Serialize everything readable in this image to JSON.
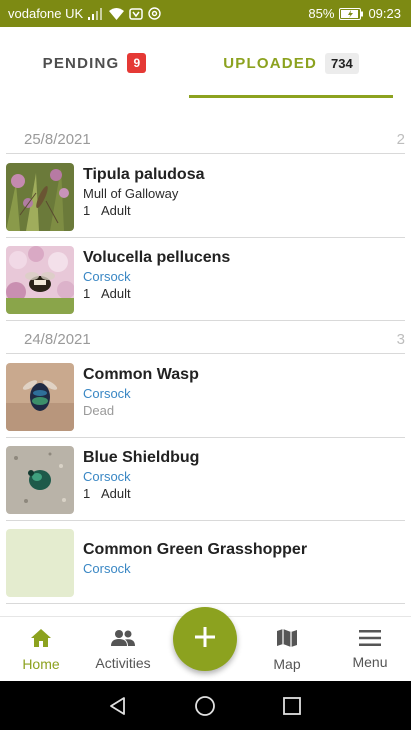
{
  "status_bar": {
    "carrier": "vodafone UK",
    "battery": "85%",
    "time": "09:23",
    "icons": [
      "signal-icon",
      "wifi-icon",
      "nfc-icon",
      "at-icon",
      "battery-icon"
    ]
  },
  "tabs": {
    "pending": {
      "label": "PENDING",
      "count": "9"
    },
    "uploaded": {
      "label": "UPLOADED",
      "count": "734",
      "active": true
    }
  },
  "groups": [
    {
      "date": "25/8/2021",
      "count": "2",
      "records": [
        {
          "name": "Tipula paludosa",
          "location": "Mull of Galloway",
          "location_color": "#2b2b2b",
          "number": "1",
          "stage": "Adult",
          "thumb": "crane-fly-photo"
        },
        {
          "name": "Volucella pellucens",
          "location": "Corsock",
          "location_color": "#3a87c4",
          "number": "1",
          "stage": "Adult",
          "thumb": "hoverfly-photo"
        }
      ]
    },
    {
      "date": "24/8/2021",
      "count": "3",
      "records": [
        {
          "name": "Common Wasp",
          "location": "Corsock",
          "location_color": "#3a87c4",
          "status": "Dead",
          "thumb": "wasp-photo"
        },
        {
          "name": "Blue Shieldbug",
          "location": "Corsock",
          "location_color": "#3a87c4",
          "number": "1",
          "stage": "Adult",
          "thumb": "shieldbug-photo"
        },
        {
          "name": "Common Green Grasshopper",
          "location": "Corsock",
          "location_color": "#3a87c4",
          "thumb": "empty-photo"
        }
      ]
    }
  ],
  "bottom_nav": {
    "home": "Home",
    "activities": "Activities",
    "map": "Map",
    "menu": "Menu",
    "active": "home"
  },
  "colors": {
    "accent": "#8ca21f",
    "status_bar": "#7d8a13",
    "badge_red": "#e53935",
    "link_blue": "#3a87c4"
  }
}
